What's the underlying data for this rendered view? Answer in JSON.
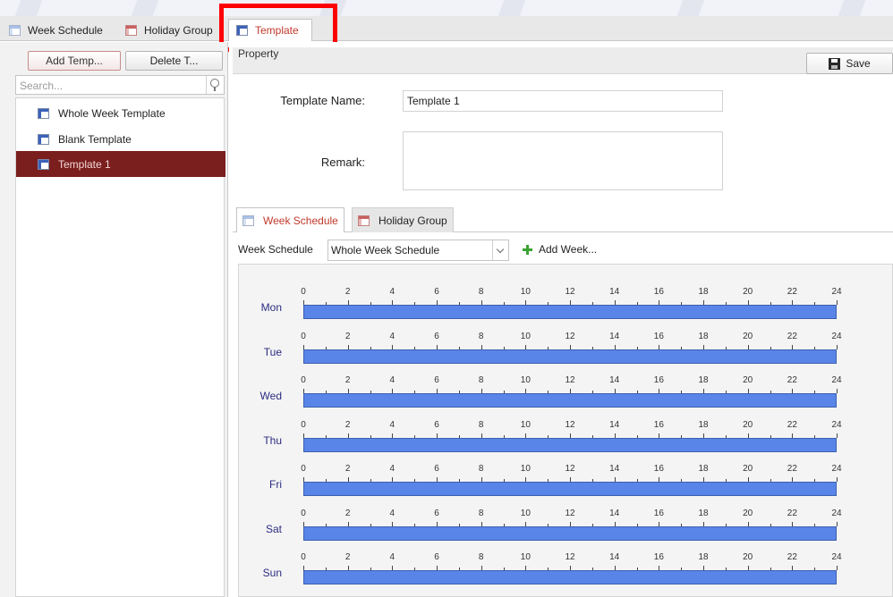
{
  "tabs": [
    {
      "label": "Week Schedule",
      "icon": "calendar-icon"
    },
    {
      "label": "Holiday Group",
      "icon": "holiday-icon"
    },
    {
      "label": "Template",
      "icon": "template-icon",
      "active": true
    }
  ],
  "left": {
    "add_button": "Add Temp...",
    "delete_button": "Delete T...",
    "search_placeholder": "Search...",
    "templates": [
      {
        "label": "Whole Week Template",
        "selected": false
      },
      {
        "label": "Blank Template",
        "selected": false
      },
      {
        "label": "Template 1",
        "selected": true
      }
    ]
  },
  "property": {
    "section_label": "Property",
    "save_label": "Save",
    "template_name_label": "Template Name:",
    "template_name_value": "Template 1",
    "remark_label": "Remark:",
    "remark_value": ""
  },
  "subtabs": [
    {
      "label": "Week Schedule",
      "active": true
    },
    {
      "label": "Holiday Group",
      "active": false
    }
  ],
  "week_schedule": {
    "label": "Week Schedule",
    "selected": "Whole Week Schedule",
    "add_week": "Add Week..."
  },
  "schedule": {
    "days": [
      {
        "label": "Mon",
        "start": 0,
        "end": 24
      },
      {
        "label": "Tue",
        "start": 0,
        "end": 24
      },
      {
        "label": "Wed",
        "start": 0,
        "end": 24
      },
      {
        "label": "Thu",
        "start": 0,
        "end": 24
      },
      {
        "label": "Fri",
        "start": 0,
        "end": 24
      },
      {
        "label": "Sat",
        "start": 0,
        "end": 24
      },
      {
        "label": "Sun",
        "start": 0,
        "end": 24
      }
    ],
    "hour_labels": [
      "0",
      "2",
      "4",
      "6",
      "8",
      "10",
      "12",
      "14",
      "16",
      "18",
      "20",
      "22",
      "24"
    ],
    "bar_color": "#5a85e8"
  },
  "colors": {
    "accent": "#c0392b",
    "selection": "#7a1e1e",
    "highlight": "#ff0000"
  }
}
